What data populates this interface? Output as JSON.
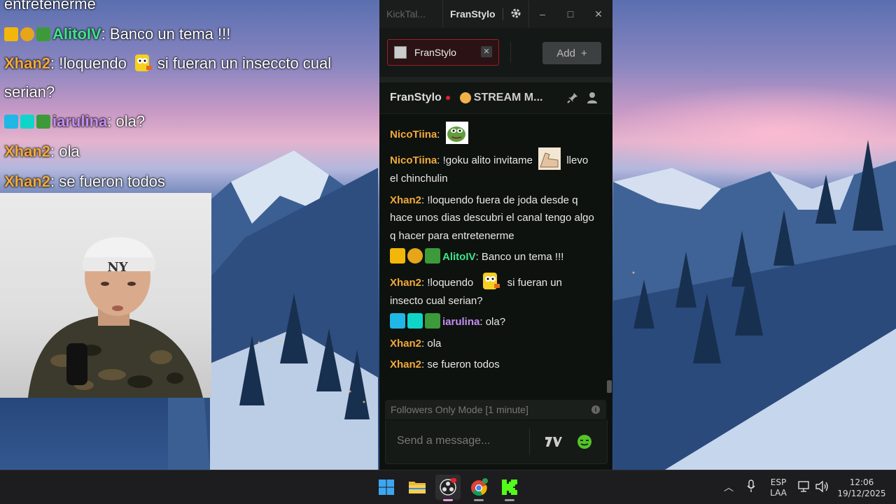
{
  "overlay": {
    "partial_line": "entretenerme",
    "lines": [
      {
        "user": "AlitoIV",
        "user_color": "#3ee68a",
        "badges": [
          "crown-badge",
          "one-badge",
          "creeper-badge"
        ],
        "text": ": Banco un tema !!!"
      },
      {
        "user": "Xhan2",
        "user_color": "#f2a93b",
        "text_before": ": !loquendo",
        "emote": "bart-emote",
        "text_after": "si fueran un inseccto cual serian?"
      },
      {
        "user": "iarulina",
        "user_color": "#c38ef0",
        "badges": [
          "sword-badge",
          "og-badge",
          "creeper-badge"
        ],
        "text": ": ola?"
      },
      {
        "user": "Xhan2",
        "user_color": "#f2a93b",
        "text": ": ola"
      },
      {
        "user": "Xhan2",
        "user_color": "#f2a93b",
        "text": ": se fueron todos"
      }
    ]
  },
  "app": {
    "title": "KickTal...",
    "active_tab": "FranStylo",
    "settings_icon": "gear-icon",
    "window_controls": {
      "minimize": "–",
      "maximize": "□",
      "close": "✕"
    },
    "channel_tab": {
      "name": "FranStylo",
      "close": "✕"
    },
    "add_button": {
      "label": "Add",
      "icon": "+"
    },
    "chat_header": {
      "channel": "FranStylo",
      "stream_title": "STREAM M..."
    },
    "messages": [
      {
        "user": "NicoTiina",
        "user_color": "#f2a93b",
        "sep": ":",
        "emote_only": "pepe-emote"
      },
      {
        "user": "NicoTiina",
        "user_color": "#f2a93b",
        "sep": ":",
        "text": " !goku alito invitame",
        "emote": "arm-emote",
        "text_after": " llevo el chinchulin"
      },
      {
        "user": "Xhan2",
        "user_color": "#f2a93b",
        "sep": ":",
        "text": " !loquendo fuera de joda desde q hace unos dias descubri el canal tengo algo q hacer para entretenerme"
      },
      {
        "user": "AlitoIV",
        "user_color": "#3ee68a",
        "sep": ":",
        "badges": [
          "crown-badge",
          "one-badge",
          "creeper-badge"
        ],
        "text": " Banco un tema !!!"
      },
      {
        "user": "Xhan2",
        "user_color": "#f2a93b",
        "sep": ":",
        "text": " !loquendo",
        "emote": "bart-emote",
        "text_after": " si fueran un insecto cual serian?"
      },
      {
        "user": "iarulina",
        "user_color": "#c38ef0",
        "sep": ":",
        "badges": [
          "sword-badge",
          "og-badge",
          "creeper-badge"
        ],
        "text": " ola?"
      },
      {
        "user": "Xhan2",
        "user_color": "#f2a93b",
        "sep": ":",
        "text": " ola"
      },
      {
        "user": "Xhan2",
        "user_color": "#f2a93b",
        "sep": ":",
        "text": " se fueron todos"
      }
    ],
    "followers_mode": "Followers Only Mode [1 minute]",
    "composer_placeholder": "Send a message...",
    "colors": {
      "accent_red": "#d9222d",
      "kick_green": "#53fc18",
      "gold": "#f2a93b",
      "green_user": "#3ee68a",
      "purple_user": "#c38ef0"
    }
  },
  "taskbar": {
    "apps": [
      "windows-start-icon",
      "file-explorer-icon",
      "obs-icon",
      "chrome-icon",
      "kick-icon"
    ],
    "language": "ESP",
    "layout": "LAA",
    "time": "12:06",
    "date": "19/12/2025"
  }
}
